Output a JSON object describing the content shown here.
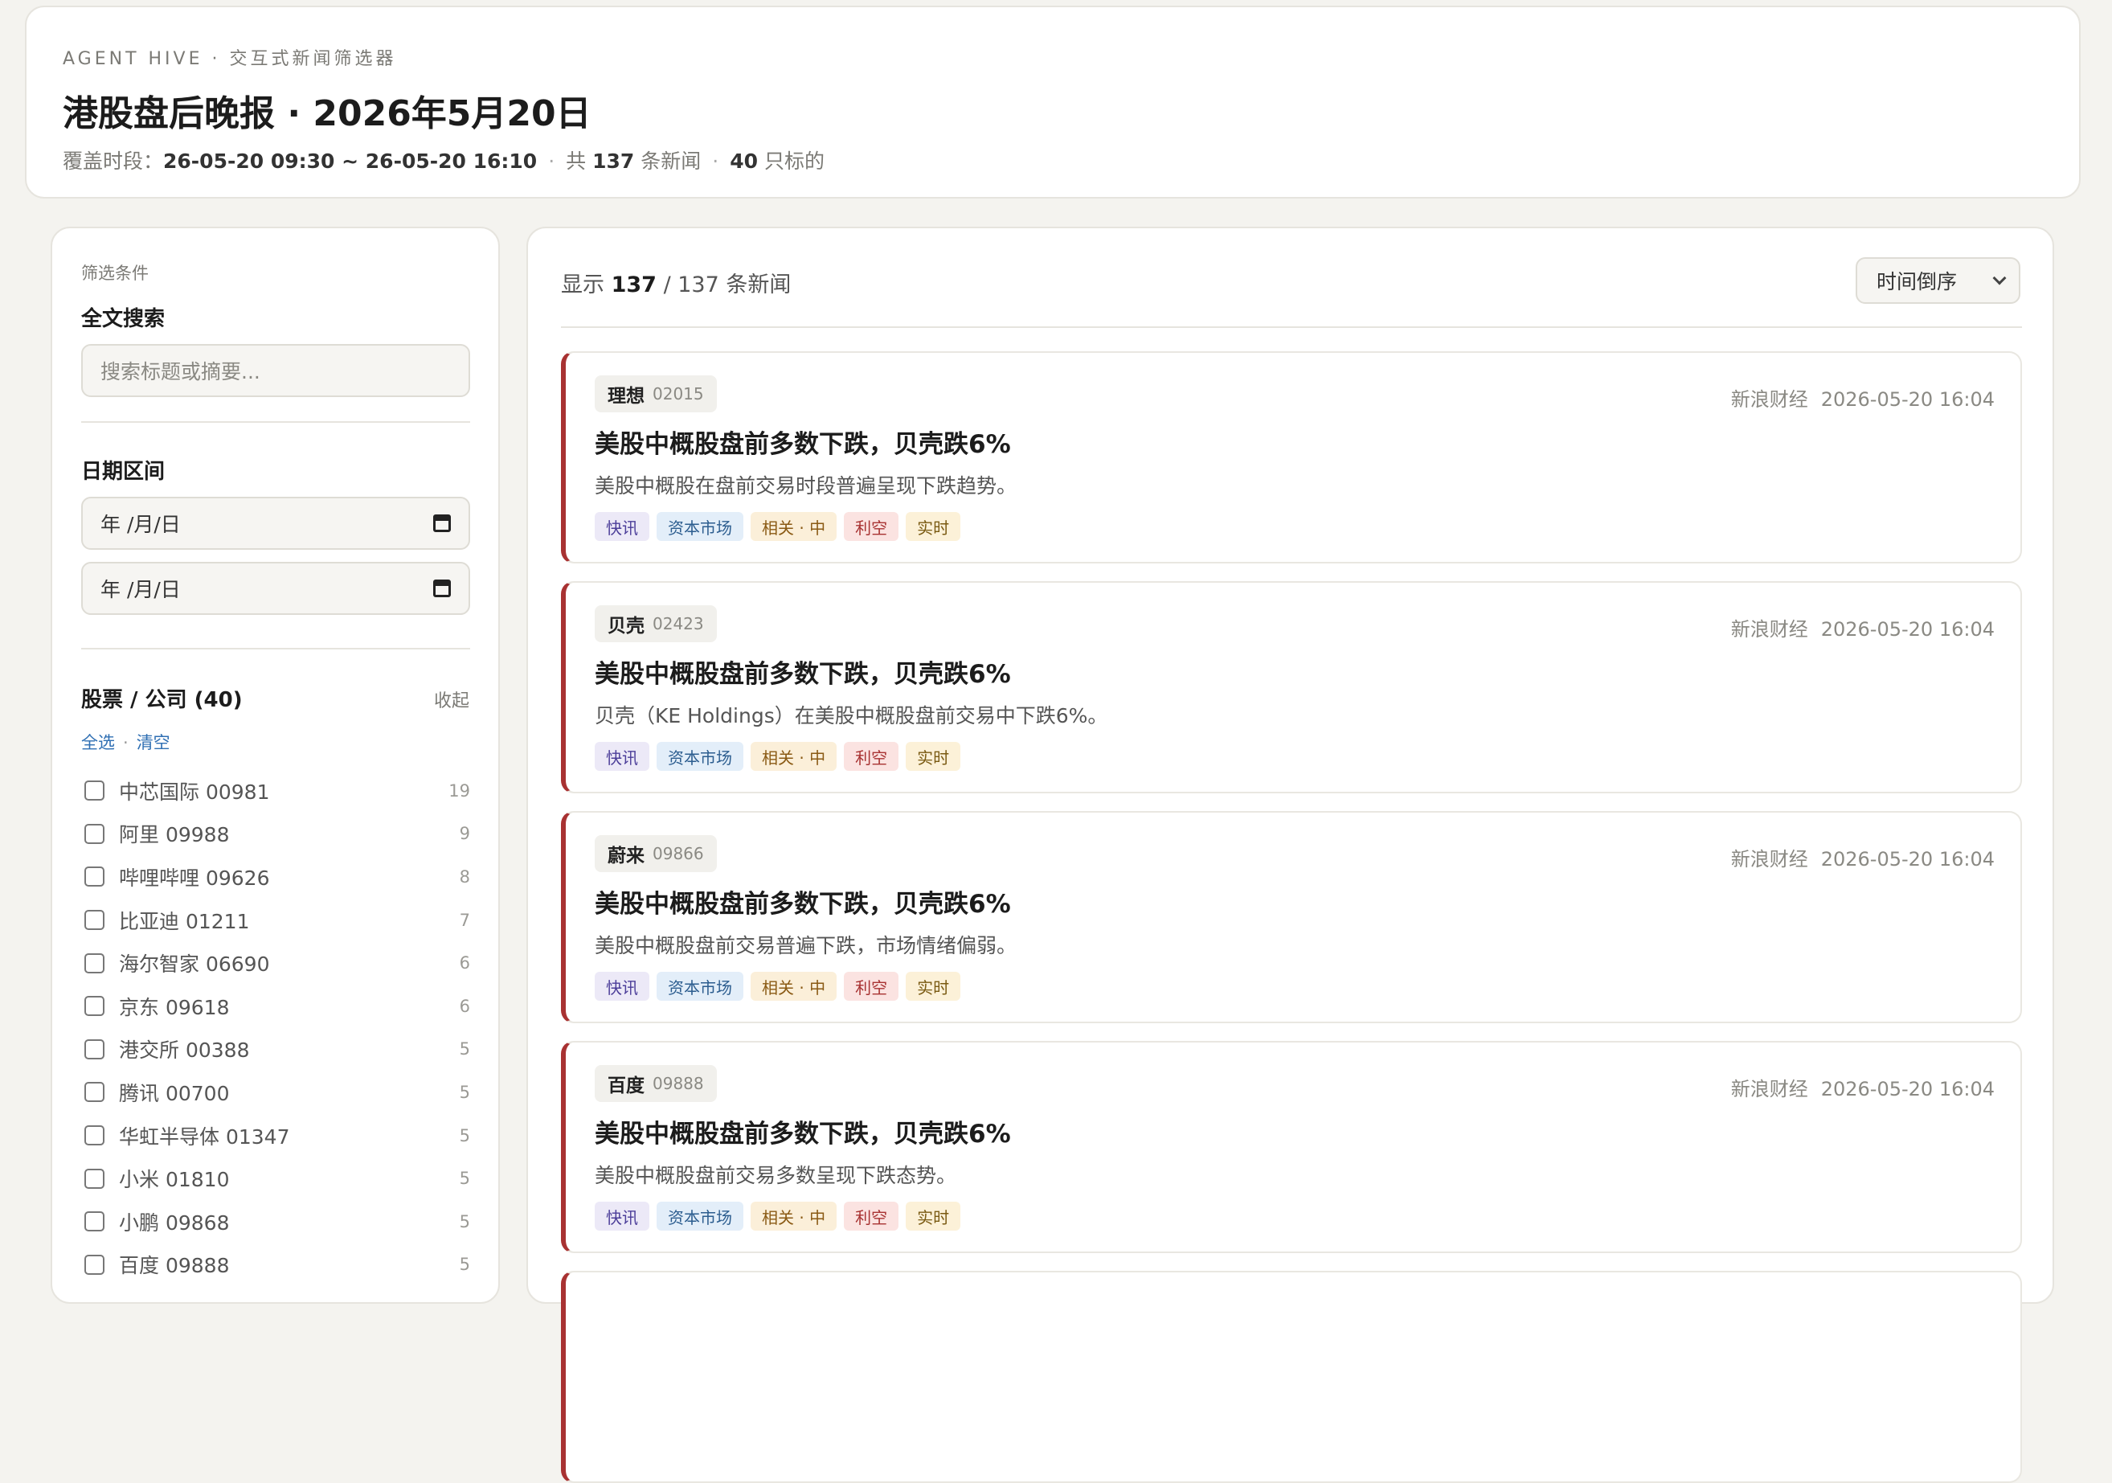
{
  "header": {
    "eyebrow": "AGENT HIVE · 交互式新闻筛选器",
    "title": "港股盘后晚报 · 2026年5月20日",
    "range_label": "覆盖时段：",
    "range_value": "26-05-20 09:30 ~ 26-05-20 16:10",
    "total_prefix": "共",
    "total_count": "137",
    "total_suffix": "条新闻",
    "stock_count": "40",
    "stock_suffix": "只标的"
  },
  "sidebar": {
    "caption": "筛选条件",
    "search_heading": "全文搜索",
    "search_placeholder": "搜索标题或摘要...",
    "date_heading": "日期区间",
    "date_from": "年 /月/日",
    "date_to": "年 /月/日",
    "stocks_heading": "股票 / 公司 (40)",
    "collapse_label": "收起",
    "select_all": "全选",
    "clear": "清空",
    "stocks": [
      {
        "label": "中芯国际 00981",
        "count": "19"
      },
      {
        "label": "阿里 09988",
        "count": "9"
      },
      {
        "label": "哔哩哔哩 09626",
        "count": "8"
      },
      {
        "label": "比亚迪 01211",
        "count": "7"
      },
      {
        "label": "海尔智家 06690",
        "count": "6"
      },
      {
        "label": "京东 09618",
        "count": "6"
      },
      {
        "label": "港交所 00388",
        "count": "5"
      },
      {
        "label": "腾讯 00700",
        "count": "5"
      },
      {
        "label": "华虹半导体 01347",
        "count": "5"
      },
      {
        "label": "小米 01810",
        "count": "5"
      },
      {
        "label": "小鹏 09868",
        "count": "5"
      },
      {
        "label": "百度 09888",
        "count": "5"
      }
    ]
  },
  "main": {
    "showing_prefix": "显示",
    "showing_count": "137",
    "showing_suffix": "/ 137 条新闻",
    "sort_label": "时间倒序",
    "accent_color": "#a83232",
    "news": [
      {
        "ticker_name": "理想",
        "ticker_code": "02015",
        "source": "新浪财经",
        "time": "2026-05-20 16:04",
        "title": "美股中概股盘前多数下跌，贝壳跌6%",
        "summary": "美股中概股在盘前交易时段普遍呈现下跌趋势。",
        "tags": [
          "快讯",
          "资本市场",
          "相关 · 中",
          "利空",
          "实时"
        ]
      },
      {
        "ticker_name": "贝壳",
        "ticker_code": "02423",
        "source": "新浪财经",
        "time": "2026-05-20 16:04",
        "title": "美股中概股盘前多数下跌，贝壳跌6%",
        "summary": "贝壳（KE Holdings）在美股中概股盘前交易中下跌6%。",
        "tags": [
          "快讯",
          "资本市场",
          "相关 · 中",
          "利空",
          "实时"
        ]
      },
      {
        "ticker_name": "蔚来",
        "ticker_code": "09866",
        "source": "新浪财经",
        "time": "2026-05-20 16:04",
        "title": "美股中概股盘前多数下跌，贝壳跌6%",
        "summary": "美股中概股盘前交易普遍下跌，市场情绪偏弱。",
        "tags": [
          "快讯",
          "资本市场",
          "相关 · 中",
          "利空",
          "实时"
        ]
      },
      {
        "ticker_name": "百度",
        "ticker_code": "09888",
        "source": "新浪财经",
        "time": "2026-05-20 16:04",
        "title": "美股中概股盘前多数下跌，贝壳跌6%",
        "summary": "美股中概股盘前交易多数呈现下跌态势。",
        "tags": [
          "快讯",
          "资本市场",
          "相关 · 中",
          "利空",
          "实时"
        ]
      }
    ]
  }
}
